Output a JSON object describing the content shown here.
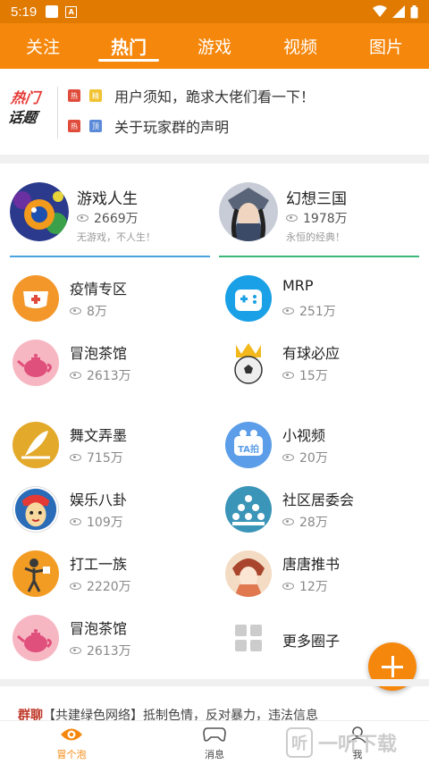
{
  "status_bar": {
    "time": "5:19",
    "icon_a": "A"
  },
  "top_nav": {
    "tabs": [
      {
        "label": "关注",
        "active": false
      },
      {
        "label": "热门",
        "active": true
      },
      {
        "label": "游戏",
        "active": false
      },
      {
        "label": "视频",
        "active": false
      },
      {
        "label": "图片",
        "active": false
      }
    ]
  },
  "hot_topics": {
    "logo_line1": "热门",
    "logo_line2": "话题",
    "items": [
      {
        "badge1": "热",
        "badge2": "精",
        "text": "用户须知，跪求大佬们看一下！"
      },
      {
        "badge1": "热",
        "badge2": "顶",
        "text": "关于玩家群的声明"
      }
    ]
  },
  "featured": [
    {
      "name": "游戏人生",
      "views": "2669万",
      "slogan": "无游戏，不人生！",
      "underline_color": "#4aa3df"
    },
    {
      "name": "幻想三国",
      "views": "1978万",
      "slogan": "永恒的经典！",
      "underline_color": "#3cb878"
    }
  ],
  "circles": [
    {
      "name": "疫情专区",
      "views": "8万",
      "icon": "mask-icon"
    },
    {
      "name": "MRP",
      "views": "251万",
      "icon": "gamepad-icon"
    },
    {
      "name": "冒泡茶馆",
      "views": "2613万",
      "icon": "teapot-icon"
    },
    {
      "name": "有球必应",
      "views": "15万",
      "icon": "soccer-icon"
    },
    {
      "name": "舞文弄墨",
      "views": "715万",
      "icon": "quill-icon"
    },
    {
      "name": "小视频",
      "views": "20万",
      "icon": "video-icon",
      "icon_text": "TA拍"
    },
    {
      "name": "娱乐八卦",
      "views": "109万",
      "icon": "opera-mask-icon"
    },
    {
      "name": "社区居委会",
      "views": "28万",
      "icon": "community-icon"
    },
    {
      "name": "打工一族",
      "views": "2220万",
      "icon": "worker-icon"
    },
    {
      "name": "唐唐推书",
      "views": "12万",
      "icon": "book-girl-icon"
    },
    {
      "name": "冒泡茶馆",
      "views": "2613万",
      "icon": "teapot-icon"
    },
    {
      "name": "更多圈子",
      "views": "",
      "icon": "grid-icon"
    }
  ],
  "peek_text": {
    "prefix": "群聊",
    "text": "【共建绿色网络】抵制色情，反对暴力，违法信息"
  },
  "bottom_nav": [
    {
      "label": "冒个泡",
      "icon": "eye-icon",
      "active": true
    },
    {
      "label": "消息",
      "icon": "gamepad-outline-icon",
      "active": false
    },
    {
      "label": "我",
      "icon": "user-icon",
      "active": false
    }
  ],
  "watermark": {
    "icon_text": "听",
    "text": "一听下载"
  },
  "colors": {
    "brand": "#f5870c",
    "statusbar": "#e07a00"
  }
}
